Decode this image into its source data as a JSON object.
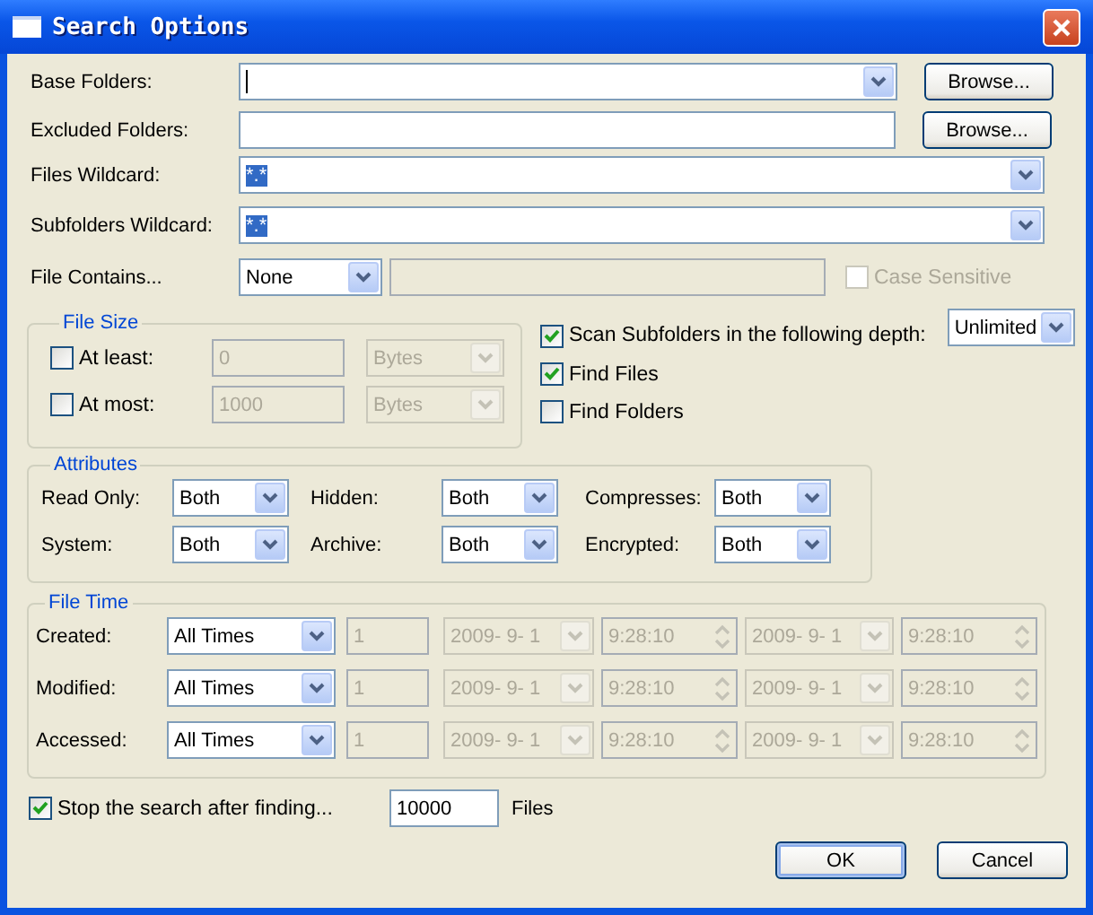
{
  "window": {
    "title": "Search Options"
  },
  "folder_rows": [
    {
      "kind": "combo",
      "label": "Base Folders:",
      "cursor": true,
      "button": "Browse..."
    },
    {
      "kind": "text",
      "label": "Excluded Folders:",
      "button": "Browse..."
    },
    {
      "kind": "combo",
      "label": "Files Wildcard:",
      "value": "*.*",
      "text_selected": true
    },
    {
      "kind": "combo",
      "label": "Subfolders Wildcard:",
      "value": "*.*",
      "text_selected": true
    }
  ],
  "file_contains": {
    "label": "File Contains...",
    "value": "None",
    "text_disabled": true,
    "case_sensitive": {
      "label": "Case Sensitive",
      "checked": false,
      "disabled": true
    }
  },
  "file_size": {
    "title": "File Size",
    "rows": [
      {
        "label": "At least:",
        "checked": false,
        "value": "0",
        "unit": "Bytes",
        "disabled": true
      },
      {
        "label": "At most:",
        "checked": false,
        "value": "1000",
        "unit": "Bytes",
        "disabled": true
      }
    ]
  },
  "scan_options": [
    {
      "label": "Scan Subfolders in the following depth:",
      "checked": true
    },
    {
      "label": "Find Files",
      "checked": true
    },
    {
      "label": "Find Folders",
      "checked": false
    }
  ],
  "depth": {
    "value": "Unlimited"
  },
  "attributes": {
    "title": "Attributes",
    "items": [
      {
        "label": "Read Only:",
        "value": "Both"
      },
      {
        "label": "Hidden:",
        "value": "Both"
      },
      {
        "label": "Compresses:",
        "value": "Both"
      },
      {
        "label": "System:",
        "value": "Both"
      },
      {
        "label": "Archive:",
        "value": "Both"
      },
      {
        "label": "Encrypted:",
        "value": "Both"
      }
    ]
  },
  "file_time": {
    "title": "File Time",
    "rows": [
      {
        "label": "Created:",
        "value": "All Times",
        "count": "1",
        "from_date": "2009- 9- 1",
        "from_time": "9:28:10",
        "to_date": "2009- 9- 1",
        "to_time": "9:28:10",
        "disabled": true
      },
      {
        "label": "Modified:",
        "value": "All Times",
        "count": "1",
        "from_date": "2009- 9- 1",
        "from_time": "9:28:10",
        "to_date": "2009- 9- 1",
        "to_time": "9:28:10",
        "disabled": true
      },
      {
        "label": "Accessed:",
        "value": "All Times",
        "count": "1",
        "from_date": "2009- 9- 1",
        "from_time": "9:28:10",
        "to_date": "2009- 9- 1",
        "to_time": "9:28:10",
        "disabled": true
      }
    ]
  },
  "stop": {
    "label": "Stop the search after finding...",
    "checked": true,
    "value": "10000",
    "unit": "Files"
  },
  "buttons": [
    {
      "label": "OK",
      "default": true
    },
    {
      "label": "Cancel",
      "default": false
    }
  ]
}
